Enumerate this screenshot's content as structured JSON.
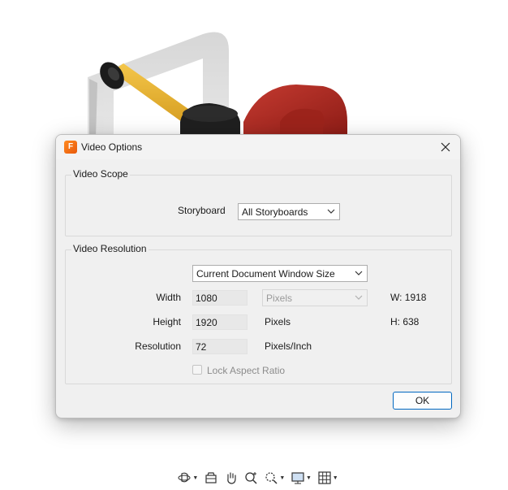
{
  "dialog": {
    "title": "Video Options",
    "close_glyph": "✕",
    "app_icon": "fusion-app-icon",
    "app_icon_letter": "F",
    "video_scope": {
      "legend": "Video Scope",
      "storyboard_label": "Storyboard",
      "storyboard_value": "All Storyboards"
    },
    "video_resolution": {
      "legend": "Video Resolution",
      "preset_value": "Current Document Window Size",
      "width_label": "Width",
      "width_value": "1080",
      "height_label": "Height",
      "height_value": "1920",
      "resolution_label": "Resolution",
      "resolution_value": "72",
      "units_value": "Pixels",
      "height_units": "Pixels",
      "resolution_units": "Pixels/Inch",
      "window_width": "W: 1918",
      "window_height": "H: 638",
      "lock_aspect_label": "Lock Aspect Ratio",
      "lock_aspect_checked": false
    },
    "ok_label": "OK"
  },
  "toolbar": {
    "items": [
      {
        "icon": "orbit-icon",
        "has_dropdown": true
      },
      {
        "icon": "look-at-icon",
        "has_dropdown": false
      },
      {
        "icon": "pan-hand-icon",
        "has_dropdown": false
      },
      {
        "icon": "zoom-icon",
        "has_dropdown": false
      },
      {
        "icon": "zoom-window-icon",
        "has_dropdown": true
      },
      {
        "icon": "display-settings-icon",
        "has_dropdown": true
      },
      {
        "icon": "grid-icon",
        "has_dropdown": true
      }
    ]
  },
  "colors": {
    "dialog_bg": "#f0f0f0",
    "ok_border": "#0067c0",
    "app_icon": "#f07a1a",
    "rod": "#e9b12f",
    "part_red": "#b3261e",
    "ghost": "#c8c8c8"
  }
}
